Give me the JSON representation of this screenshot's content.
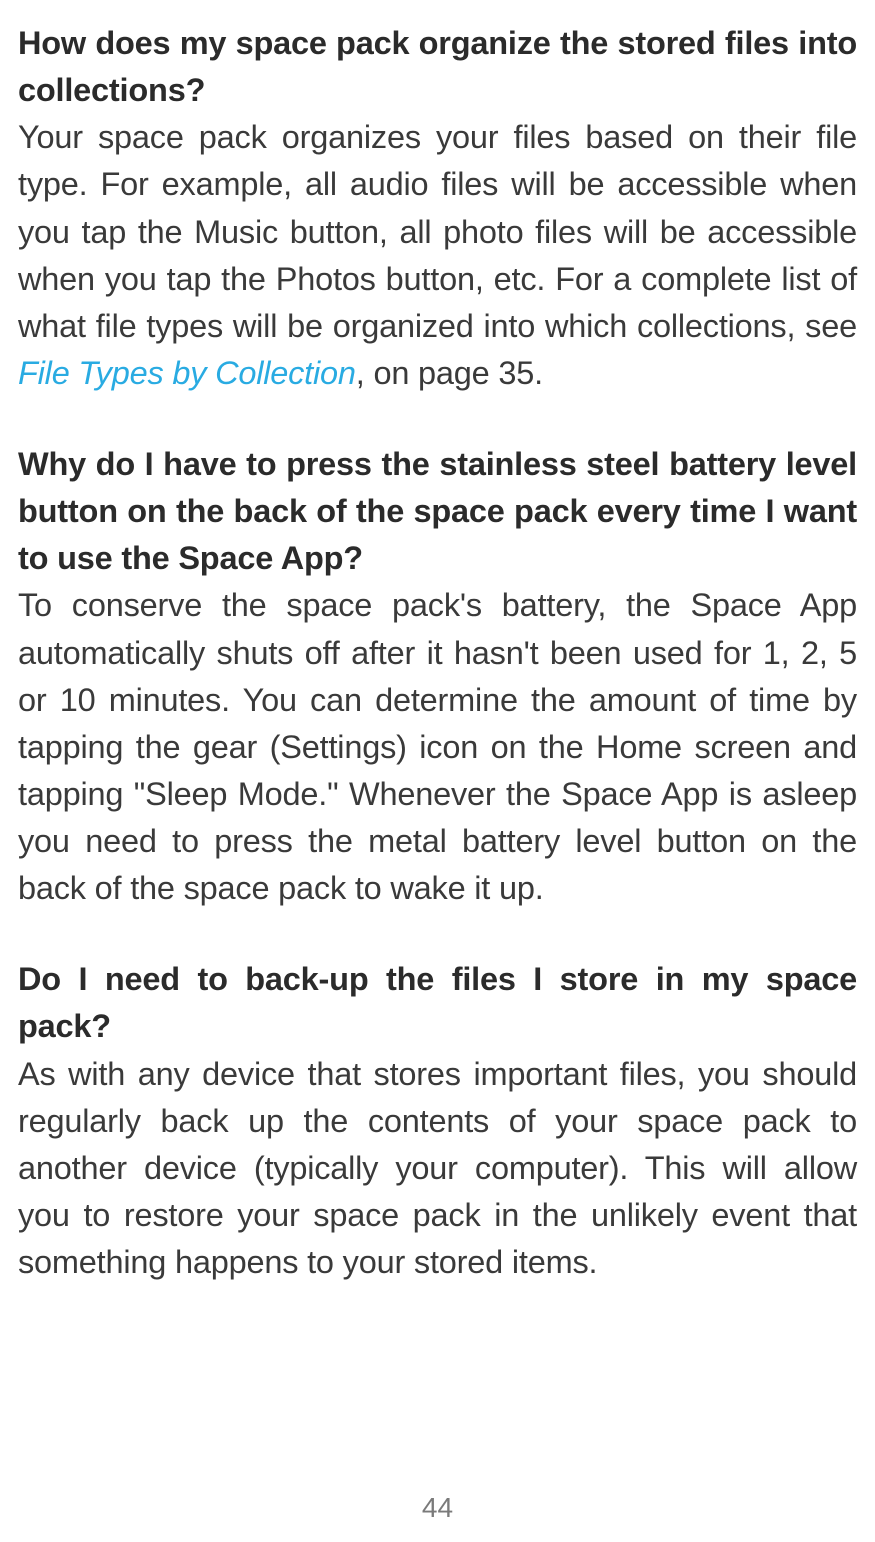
{
  "sections": [
    {
      "question": "How does my space pack organize the stored files into collections?",
      "answer_before_link": "Your space pack organizes your files based on their file type. For example, all audio files will be accessible when you tap the Music button, all photo files will be accessible when you tap the Photos button, etc. For a complete list of what file types will be organized into which collections, see ",
      "link_text": "File Types by Collection",
      "answer_after_link": ", on page 35."
    },
    {
      "question": "Why do I have to press the stainless steel battery level button on the back of the space pack every time I want to use the Space App?",
      "answer": "To conserve the space pack's battery, the Space App automatically shuts off after it hasn't been used for 1, 2, 5 or 10 minutes. You can determine the amount of time by tapping the gear (Settings) icon on the Home screen and tapping \"Sleep Mode.\" Whenever the Space App is asleep you need to press the metal battery level button on the back of the space pack to wake it up."
    },
    {
      "question": "Do I need to back-up the files I store in my space pack?",
      "answer": "As with any device that stores important files, you should regularly back up the contents of your space pack to another device (typically your computer). This will allow you to restore your space pack in the unlikely event that something happens to your stored items."
    }
  ],
  "page_number": "44"
}
